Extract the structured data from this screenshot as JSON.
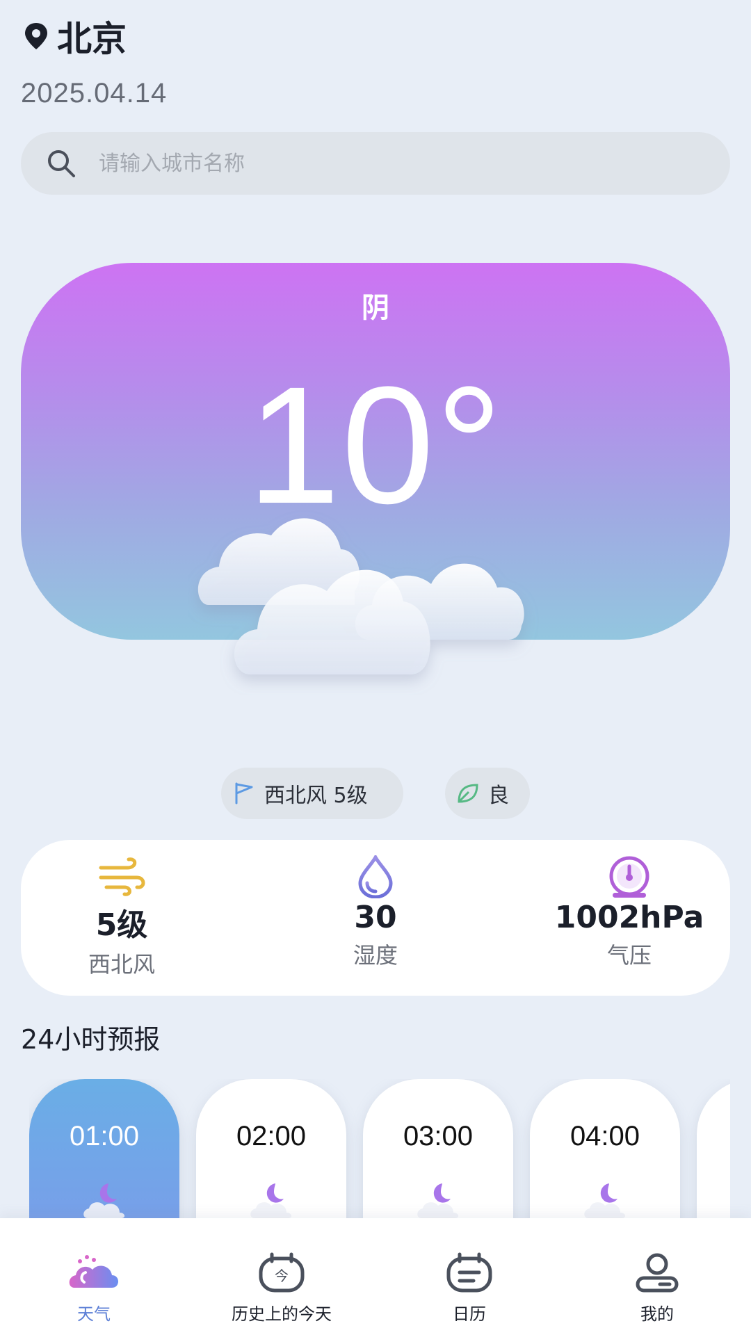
{
  "header": {
    "city": "北京",
    "date": "2025.04.14",
    "location_icon": "location-pin-icon"
  },
  "search": {
    "placeholder": "请输入城市名称",
    "value": "",
    "icon": "search-icon"
  },
  "current": {
    "condition": "阴",
    "temperature": "10°",
    "icon": "cloudy-icon"
  },
  "chips": {
    "wind": "西北风 5级",
    "wind_icon": "wind-flag-icon",
    "air_quality": "良",
    "air_quality_icon": "leaf-icon"
  },
  "stats": [
    {
      "value": "5级",
      "label": "西北风",
      "icon": "wind-icon",
      "color": "#e7b73d"
    },
    {
      "value": "30",
      "label": "湿度",
      "icon": "water-drop-icon",
      "color": "#8a7bdc"
    },
    {
      "value": "1002hPa",
      "label": "气压",
      "icon": "pressure-gauge-icon",
      "color": "#b05fd8"
    }
  ],
  "forecast": {
    "title": "24小时预报",
    "hours": [
      {
        "time": "01:00",
        "icon": "moon-cloud-icon",
        "active": true
      },
      {
        "time": "02:00",
        "icon": "moon-cloud-icon",
        "active": false
      },
      {
        "time": "03:00",
        "icon": "moon-cloud-icon",
        "active": false
      },
      {
        "time": "04:00",
        "icon": "moon-cloud-icon",
        "active": false
      }
    ]
  },
  "nav": {
    "items": [
      {
        "label": "天气",
        "icon": "weather-icon",
        "active": true
      },
      {
        "label": "历史上的今天",
        "icon": "today-in-history-icon",
        "active": false
      },
      {
        "label": "日历",
        "icon": "calendar-icon",
        "active": false
      },
      {
        "label": "我的",
        "icon": "profile-icon",
        "active": false
      }
    ]
  },
  "colors": {
    "background": "#e8eef7",
    "hero_top": "#cd73f3",
    "hero_bottom": "#93c6df",
    "active_nav": "#5c7fd6"
  }
}
